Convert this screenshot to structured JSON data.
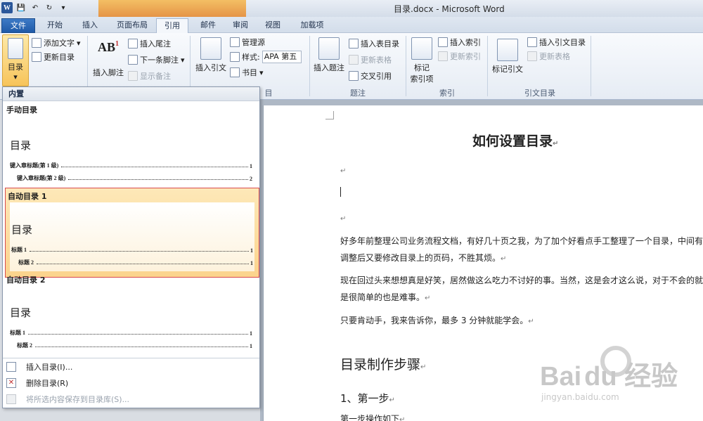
{
  "window": {
    "title": "目录.docx - Microsoft Word"
  },
  "tabs": [
    {
      "label": "文件",
      "state": "file"
    },
    {
      "label": "开始"
    },
    {
      "label": "插入"
    },
    {
      "label": "页面布局"
    },
    {
      "label": "引用",
      "state": "active"
    },
    {
      "label": "邮件"
    },
    {
      "label": "审阅"
    },
    {
      "label": "视图"
    },
    {
      "label": "加载项"
    }
  ],
  "ribbon": {
    "toc": {
      "button": "目录",
      "add_text": "添加文字",
      "update_toc": "更新目录"
    },
    "footnotes": {
      "insert_footnote": "插入脚注",
      "ab_glyph": "AB",
      "ab_sup": "1",
      "insert_endnote": "插入尾注",
      "next_footnote": "下一条脚注",
      "show_notes": "显示备注"
    },
    "citations": {
      "insert_citation": "插入引文",
      "manage_sources": "管理源",
      "style_label": "样式:",
      "style_value": "APA 第五",
      "bibliography": "书目",
      "group_label_partial": "目"
    },
    "captions": {
      "insert_caption": "插入题注",
      "insert_table_of_figures": "插入表目录",
      "update_table": "更新表格",
      "cross_reference": "交叉引用",
      "group_label": "题注"
    },
    "index": {
      "mark_entry_line1": "标记",
      "mark_entry_line2": "索引项",
      "insert_index": "插入索引",
      "update_index": "更新索引",
      "group_label": "索引"
    },
    "toa": {
      "mark_citation": "标记引文",
      "insert_toa": "插入引文目录",
      "update_table": "更新表格",
      "group_label": "引文目录"
    }
  },
  "toc_gallery": {
    "section_header": "内置",
    "items": [
      {
        "name": "手动目录",
        "heading": "目录",
        "lines": [
          {
            "text": "键入章标题(第 1 级)",
            "page": "1",
            "level": 1
          },
          {
            "text": "键入章标题(第 2 级)",
            "page": "2",
            "level": 2
          }
        ]
      },
      {
        "name": "自动目录 1",
        "selected": true,
        "heading": "目录",
        "lines": [
          {
            "text": "标题 1",
            "page": "1",
            "level": 1
          },
          {
            "text": "标题 2",
            "page": "1",
            "level": 2
          }
        ]
      },
      {
        "name": "自动目录 2",
        "heading": "目录",
        "lines": [
          {
            "text": "标题 1",
            "page": "1",
            "level": 1
          },
          {
            "text": "标题 2",
            "page": "1",
            "level": 2
          }
        ]
      }
    ],
    "menu": [
      {
        "label": "插入目录(I)...",
        "enabled": true
      },
      {
        "label": "删除目录(R)",
        "enabled": true
      },
      {
        "label": "将所选内容保存到目录库(S)...",
        "enabled": false
      }
    ]
  },
  "document": {
    "title": "如何设置目录",
    "paragraph_mark": "↵",
    "paragraphs": [
      "好多年前整理公司业务流程文档，有好几十页之我，为了加个好看点手工整理了一个目录，中间有调整后又要修改目录上的页码，不胜其烦。",
      "现在回过头来想想真是好笑，居然做这么吃力不讨好的事。当然，这是会才这么说，对于不会的就是很简单的也是难事。",
      "只要肯动手，我来告诉你，最多 3 分钟就能学会。"
    ],
    "heading2": "目录制作步骤",
    "heading3": "1、第一步",
    "partial_line": "第一步操作如下"
  },
  "watermark": {
    "brand": "Bai",
    "brand_suffix": "du 经验",
    "url": "jingyan.baidu.com"
  },
  "colors": {
    "file_tab": "#2b5fa8",
    "selected_border": "#d8494d",
    "selected_fill": "#fbd38c"
  }
}
